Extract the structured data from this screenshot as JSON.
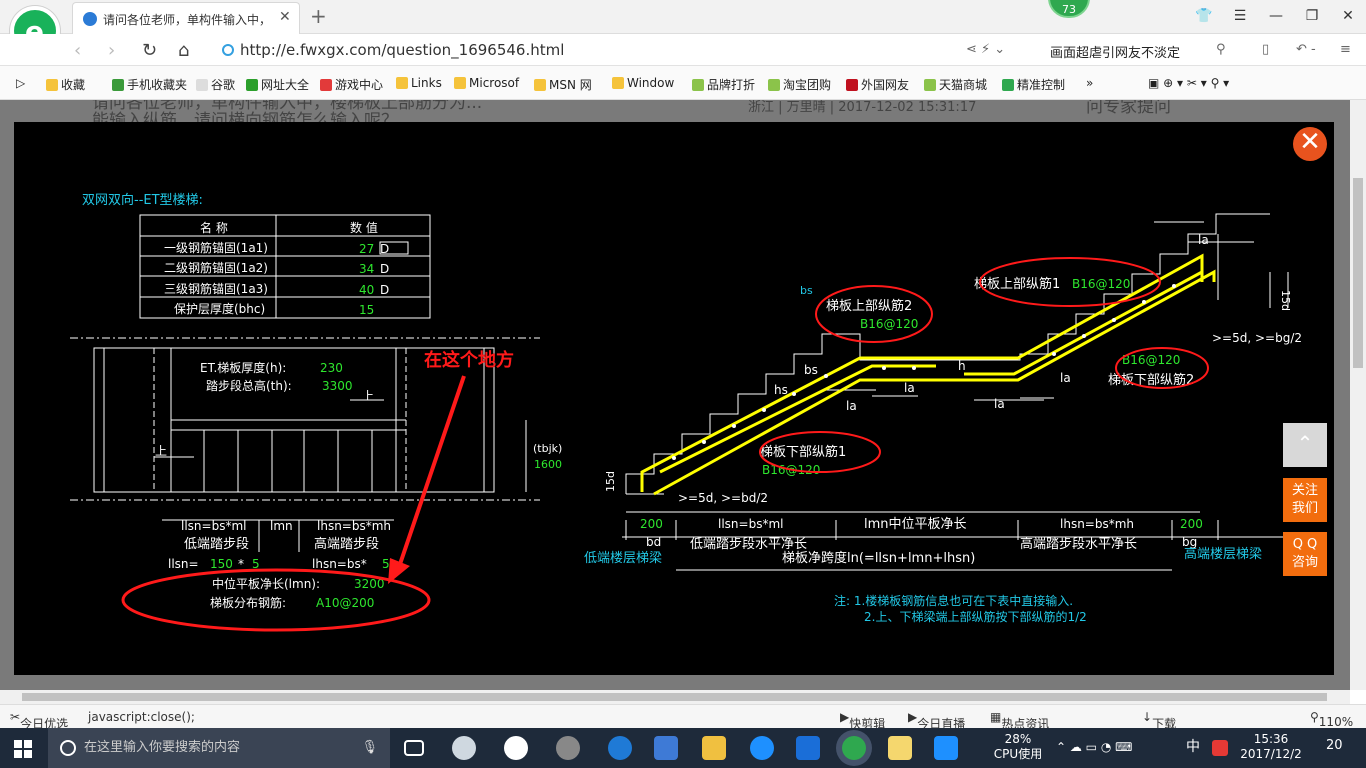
{
  "browser": {
    "tab_title": "请问各位老师，单构件输入中，",
    "url": "http://e.fwxgx.com/question_1696546.html",
    "news_ticker": "画面超虐引网友不淡定",
    "notification_badge": "73"
  },
  "bookmarks": [
    "收藏",
    "手机收藏夹",
    "谷歌",
    "网址大全",
    "游戏中心",
    "Links",
    "Microsof",
    "MSN 网",
    "Window",
    "品牌打折",
    "淘宝团购",
    "外国网友",
    "天猫商城",
    "精准控制"
  ],
  "background_page": {
    "question_line1": "请问各位老师，单构件输入中，楼梯板上部筋分为...",
    "question_line2": "能输入纵筋，请问横向钢筋怎么输入呢？",
    "meta": "浙江 | 万里晴 | 2017-12-02 15:31:17",
    "side_title": "问专家提问"
  },
  "drawing": {
    "title": "双网双向--ET型楼梯:",
    "table_header_name": "名  称",
    "table_header_value": "数  值",
    "rows": [
      {
        "name": "一级钢筋锚固(1a1)",
        "value": "27",
        "unit": "D"
      },
      {
        "name": "二级钢筋锚固(1a2)",
        "value": "34",
        "unit": "D"
      },
      {
        "name": "三级钢筋锚固(1a3)",
        "value": "40",
        "unit": "D"
      },
      {
        "name": "保护层厚度(bhc)",
        "value": "15",
        "unit": ""
      }
    ],
    "slab_thickness_label": "ET.梯板厚度(h):",
    "slab_thickness_value": "230",
    "step_height_label": "踏步段总高(th):",
    "step_height_value": "3300",
    "up_label": "上",
    "tbjk_label": "(tbjk)",
    "tbjk_value": "1600",
    "llsn_label": "llsn=bs*ml",
    "lmn_label": "lmn",
    "lhsn_label": "lhsn=bs*mh",
    "low_step_label": "低端踏步段",
    "high_step_label": "高端踏步段",
    "llsn_eq": "llsn=",
    "llsn_val1": "150",
    "llsn_mul": "*",
    "llsn_val2": "5",
    "lhsn_eq": "lhsn=bs*",
    "lhsn_val": "5",
    "mid_plate_label": "中位平板净长(lmn):",
    "mid_plate_value": "3200",
    "dist_bar_label": "梯板分布钢筋:",
    "dist_bar_value": "A10@200",
    "annotation": "在这个地方",
    "upper_long_bar2": "梯板上部纵筋2",
    "upper_long_bar2_val": "B16@120",
    "upper_long_bar1": "梯板上部纵筋1",
    "upper_long_bar1_val": "B16@120",
    "lower_long_bar2_val": "B16@120",
    "lower_long_bar2": "梯板下部纵筋2",
    "lower_long_bar1": "梯板下部纵筋1",
    "lower_long_bar1_val": "B16@120",
    "la": "la",
    "bs": "bs",
    "hs": "hs",
    "h": "h",
    "d15": "15d",
    "ge5d_bd": ">=5d, >=bd/2",
    "ge5d_bg": ">=5d, >=bg/2",
    "bd_value": "200",
    "bd": "bd",
    "bg_value": "200",
    "bg": "bg",
    "low_horiz": "低端踏步段水平净长",
    "mid_horiz": "lmn中位平板净长",
    "high_horiz": "高端踏步段水平净长",
    "span_label": "梯板净跨度ln(=llsn+lmn+lhsn)",
    "low_beam": "低端楼层梯梁",
    "high_beam": "高端楼层梯梁",
    "note1": "注: 1.楼梯板钢筋信息也可在下表中直接输入.",
    "note2": "2.上、下梯梁端上部纵筋按下部纵筋的1/2"
  },
  "side_buttons": {
    "contact": "关注\n我们",
    "qq": "Q Q\n咨询"
  },
  "status": {
    "left": "今日优选",
    "link": "javascript:close();",
    "items": [
      "快剪辑",
      "今日直播",
      "热点资讯",
      "下载"
    ],
    "zoom": "110%"
  },
  "taskbar": {
    "search_placeholder": "在这里输入你要搜索的内容",
    "cpu_percent": "28%",
    "cpu_label": "CPU使用",
    "ime": "中",
    "time": "15:36",
    "date": "2017/12/2",
    "notif_count": "20"
  },
  "colors": {
    "cad_bg": "#000000",
    "cad_text": "#ffffff",
    "cad_value": "#2ee62e",
    "cad_cyan": "#22c8e6",
    "cad_yellow": "#ffff00",
    "annot_red": "#ff1a1a",
    "accent_orange": "#f26d0e"
  }
}
